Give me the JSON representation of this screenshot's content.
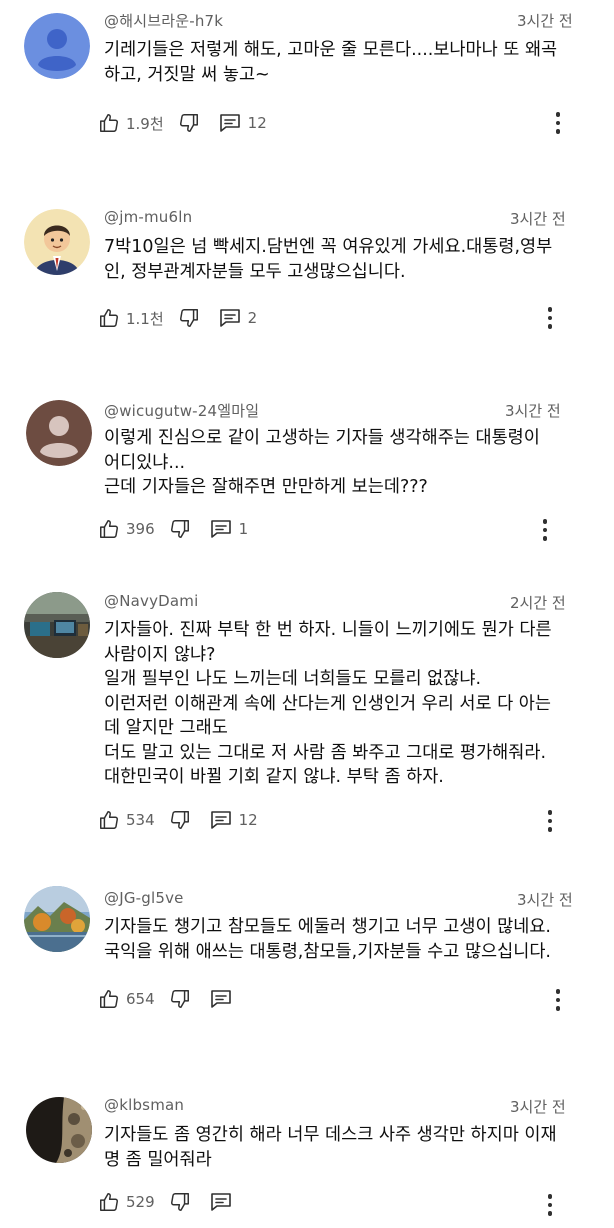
{
  "comments": [
    {
      "author": "@해시브라운-h7k",
      "time": "3시간 전",
      "avatar_type": "default-blue-person",
      "lines": [
        "기레기들은 저렇게 해도, 고마운 줄 모른다....보나마나 또 왜곡",
        "하고, 거짓말 써 놓고~"
      ],
      "likes": "1.9천",
      "replies": "12"
    },
    {
      "author": "@jm-mu6ln",
      "time": "3시간 전",
      "avatar_type": "cartoon-man-in-suit",
      "lines": [
        "7박10일은 넘 빡세지.담번엔 꼭 여유있게 가세요.대통령,영부",
        "인, 정부관계자분들 모두 고생많으십니다."
      ],
      "likes": "1.1천",
      "replies": "2"
    },
    {
      "author": "@wicugutw-24엘마일",
      "time": "3시간 전",
      "avatar_type": "default-brown-person",
      "lines": [
        "이렇게 진심으로 같이 고생하는 기자들 생각해주는 대통령이",
        "어디있냐...",
        "근데 기자들은 잘해주면 만만하게 보는데???"
      ],
      "likes": "396",
      "replies": "1"
    },
    {
      "author": "@NavyDami",
      "time": "2시간 전",
      "avatar_type": "photo-desk",
      "lines": [
        "기자들아. 진짜 부탁 한 번 하자. 니들이 느끼기에도 뭔가 다른",
        "사람이지 않냐?",
        "일개 필부인 나도 느끼는데 너희들도 모를리 없잖냐.",
        "이런저런 이해관계 속에 산다는게 인생인거 우리 서로 다 아는",
        "데 알지만 그래도",
        "더도 말고 있는 그대로 저 사람 좀 봐주고 그대로 평가해줘라.",
        "대한민국이 바뀔 기회 같지 않냐. 부탁 좀 하자."
      ],
      "likes": "534",
      "replies": "12"
    },
    {
      "author": "@JG-gl5ve",
      "time": "3시간 전",
      "avatar_type": "photo-autumn-landscape",
      "lines": [
        "기자들도 챙기고 참모들도 에둘러 챙기고 너무 고생이 많네요.",
        "국익을 위해 애쓰는 대통령,참모들,기자분들 수고 많으십니다."
      ],
      "likes": "654",
      "replies": ""
    },
    {
      "author": "@klbsman",
      "time": "3시간 전",
      "avatar_type": "photo-dark-texture",
      "lines": [
        "기자들도 좀 영간히 해라 너무 데스크 사주 생각만 하지마 이재",
        "명 좀 밀어줘라"
      ],
      "likes": "529",
      "replies": ""
    }
  ]
}
